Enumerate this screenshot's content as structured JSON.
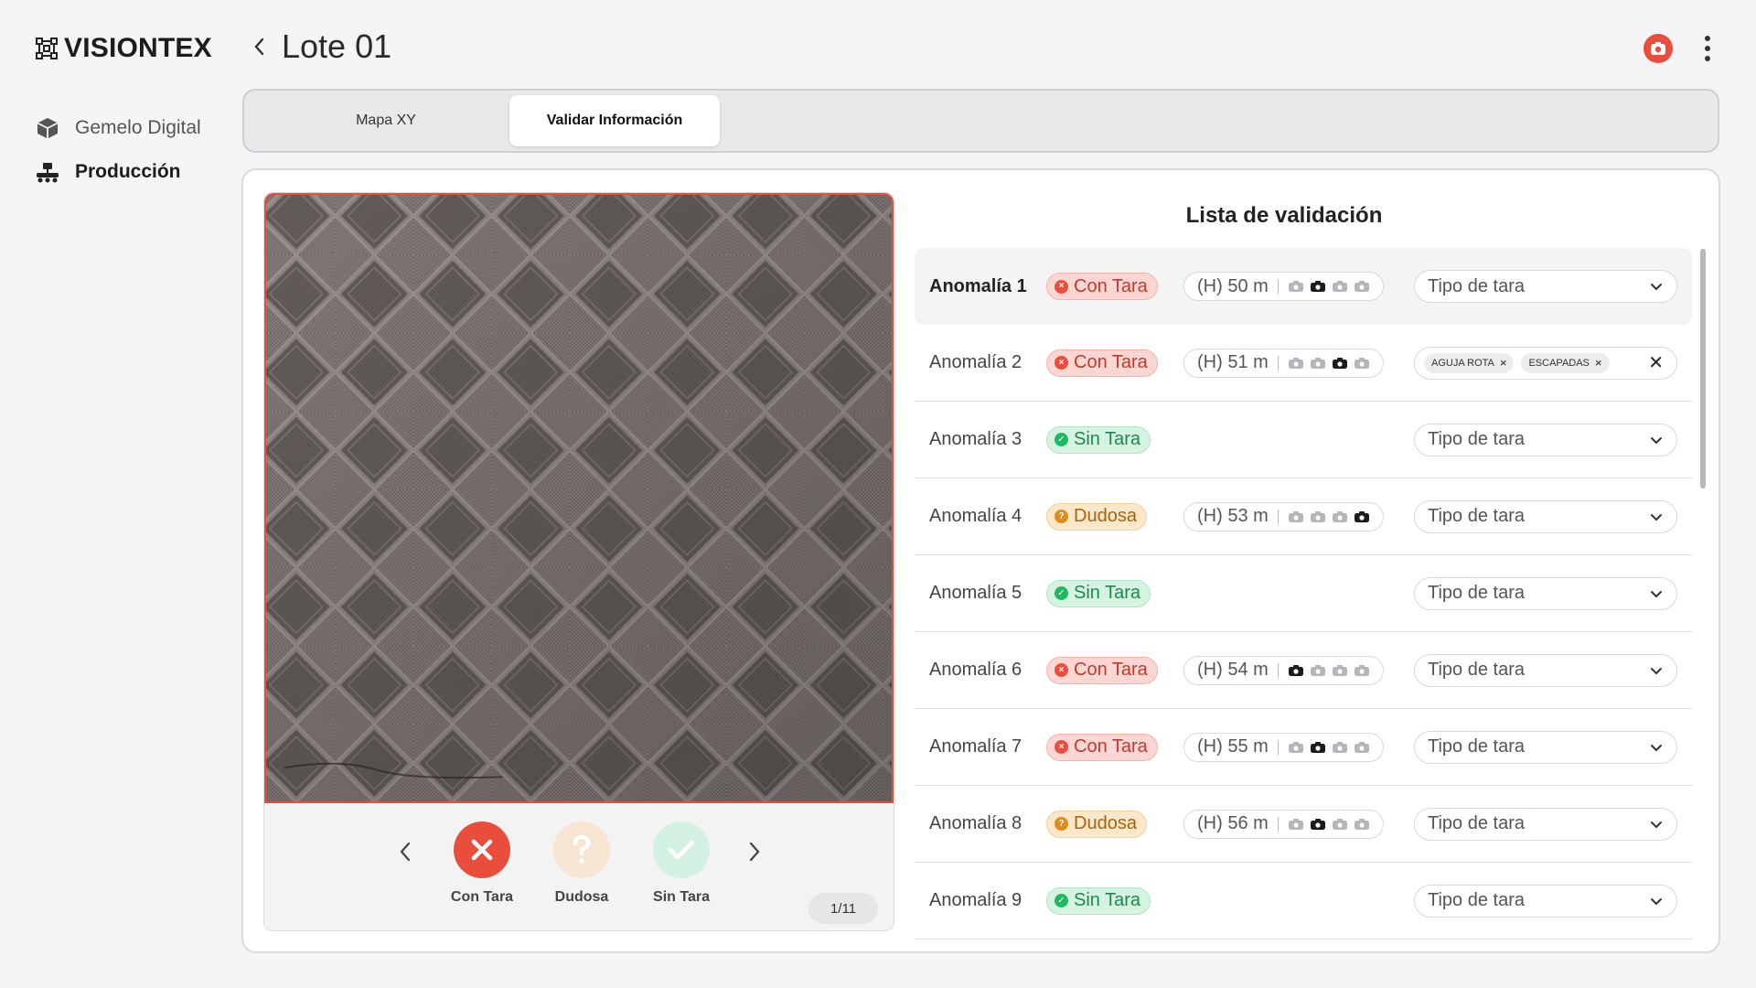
{
  "app": {
    "brand": "VISIONTEX"
  },
  "sidebar": {
    "items": [
      {
        "label": "Gemelo Digital",
        "icon": "cube-icon"
      },
      {
        "label": "Producción",
        "icon": "factory-icon"
      }
    ]
  },
  "header": {
    "title": "Lote 01"
  },
  "tabs": [
    {
      "label": "Mapa XY"
    },
    {
      "label": "Validar Información"
    }
  ],
  "viewer": {
    "buttons": {
      "con": "Con Tara",
      "dud": "Dudosa",
      "sin": "Sin Tara"
    },
    "counter": "1/11"
  },
  "list": {
    "title": "Lista de validación",
    "placeholder": "Tipo de tara",
    "rows": [
      {
        "name": "Anomalía 1",
        "status": "Con Tara",
        "meter": "(H) 50 m"
      },
      {
        "name": "Anomalía 2",
        "status": "Con Tara",
        "meter": "(H) 51 m",
        "chips": [
          "AGUJA ROTA",
          "ESCAPADAS"
        ]
      },
      {
        "name": "Anomalía 3",
        "status": "Sin Tara"
      },
      {
        "name": "Anomalía 4",
        "status": "Dudosa",
        "meter": "(H) 53 m"
      },
      {
        "name": "Anomalía 5",
        "status": "Sin Tara"
      },
      {
        "name": "Anomalía 6",
        "status": "Con Tara",
        "meter": "(H) 54 m"
      },
      {
        "name": "Anomalía 7",
        "status": "Con Tara",
        "meter": "(H) 55 m"
      },
      {
        "name": "Anomalía 8",
        "status": "Dudosa",
        "meter": "(H) 56 m"
      },
      {
        "name": "Anomalía 9",
        "status": "Sin Tara"
      }
    ]
  },
  "colors": {
    "accent_red": "#e94e3c",
    "green": "#22b862",
    "orange": "#e08a17"
  }
}
